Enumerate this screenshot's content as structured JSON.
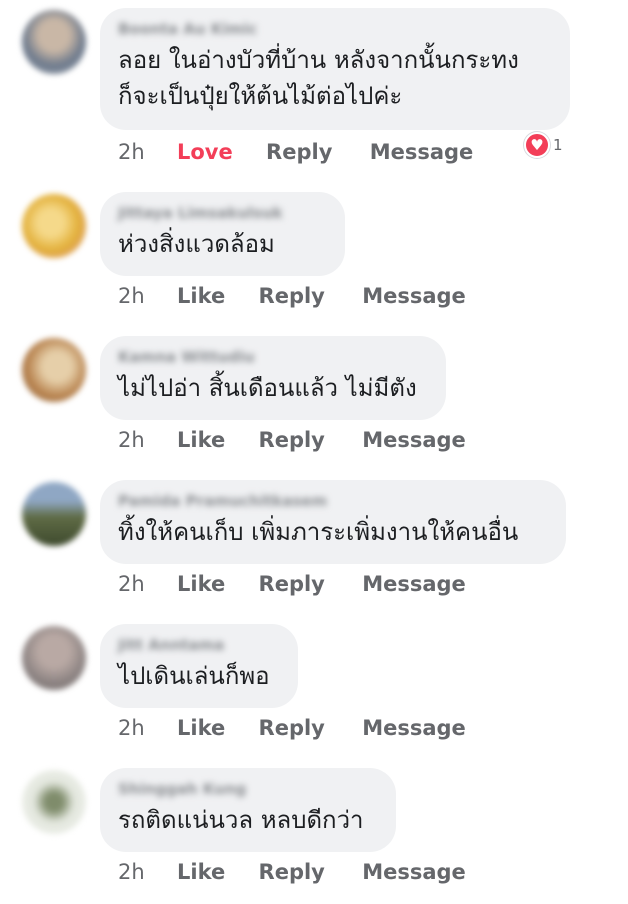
{
  "comments": [
    {
      "author": "Boonta Au Kimic",
      "text_lines": [
        "ลอย ในอ่างบัวที่บ้าน หลังจากนั้นกระทง",
        "ก็จะเป็นปุ๋ยให้ต้นไม้ต่อไปค่ะ"
      ],
      "time": "2h",
      "like": "Love",
      "reply": "Reply",
      "message": "Message",
      "reaction_count": "1",
      "avatar_colors": [
        "#6f7b8d",
        "#c9b7a6"
      ]
    },
    {
      "author": "Jittaya Limsakulsuk",
      "text_lines": [
        "ห่วงสิ่งแวดล้อม"
      ],
      "time": "2h",
      "like": "Like",
      "reply": "Reply",
      "message": "Message",
      "avatar_colors": [
        "#e3b13c",
        "#d88a7a"
      ]
    },
    {
      "author": "Kamna Wittudiu",
      "text_lines": [
        "ไม่ไปอ่า สิ้นเดือนแล้ว ไม่มีตัง"
      ],
      "time": "2h",
      "like": "Like",
      "reply": "Reply",
      "message": "Message",
      "avatar_colors": [
        "#b8834f",
        "#e6cfa9"
      ]
    },
    {
      "author": "Pamida Pramuchitkasem",
      "text_lines": [
        "ทิ้งให้คนเก็บ เพิ่มภาระเพิ่มงานให้คนอื่น"
      ],
      "time": "2h",
      "like": "Like",
      "reply": "Reply",
      "message": "Message",
      "avatar_colors": [
        "#5f6b45",
        "#8fa7c4"
      ]
    },
    {
      "author": "Jitt Anntama",
      "text_lines": [
        "ไปเดินเล่นก็พอ"
      ],
      "time": "2h",
      "like": "Like",
      "reply": "Reply",
      "message": "Message",
      "avatar_colors": [
        "#8d8483",
        "#b9a9a4"
      ]
    },
    {
      "author": "Shinggah Kung",
      "text_lines": [
        "รถติดแน่นวล หลบดีกว่า"
      ],
      "time": "2h",
      "like": "Like",
      "reply": "Reply",
      "message": "Message",
      "avatar_colors": [
        "#e2e6dd",
        "#7f8c6b"
      ]
    }
  ],
  "colors": {
    "bubble": "#f0f1f3",
    "meta": "#65676b",
    "love": "#f33e58"
  }
}
